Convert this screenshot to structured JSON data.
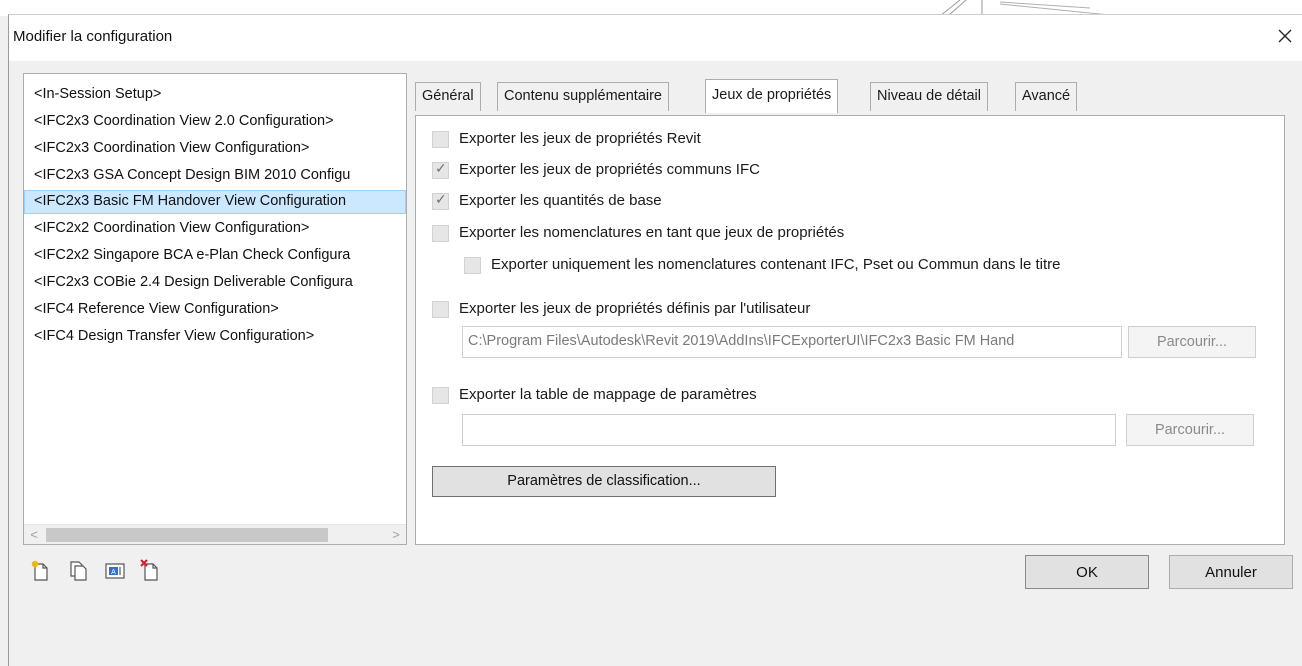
{
  "dialog": {
    "title": "Modifier la configuration",
    "close_icon": "close-icon"
  },
  "configurations": [
    {
      "label": "<In-Session Setup>",
      "selected": false
    },
    {
      "label": "<IFC2x3 Coordination View 2.0 Configuration>",
      "selected": false
    },
    {
      "label": "<IFC2x3 Coordination View Configuration>",
      "selected": false
    },
    {
      "label": "<IFC2x3 GSA Concept Design BIM 2010 Configu",
      "selected": false
    },
    {
      "label": "<IFC2x3 Basic FM Handover View Configuration",
      "selected": true
    },
    {
      "label": "<IFC2x2 Coordination View Configuration>",
      "selected": false
    },
    {
      "label": "<IFC2x2 Singapore BCA e-Plan Check Configura",
      "selected": false
    },
    {
      "label": "<IFC2x3 COBie 2.4 Design Deliverable Configura",
      "selected": false
    },
    {
      "label": "<IFC4 Reference View Configuration>",
      "selected": false
    },
    {
      "label": "<IFC4 Design Transfer View Configuration>",
      "selected": false
    }
  ],
  "list_scroll": {
    "left": "<",
    "right": ">"
  },
  "toolbar": [
    "new-configuration-icon",
    "duplicate-configuration-icon",
    "rename-configuration-icon",
    "delete-configuration-icon"
  ],
  "tabs": [
    {
      "label": "Général",
      "active": false
    },
    {
      "label": "Contenu supplémentaire",
      "active": false
    },
    {
      "label": "Jeux de propriétés",
      "active": true
    },
    {
      "label": "Niveau de détail",
      "active": false
    },
    {
      "label": "Avancé",
      "active": false
    }
  ],
  "property_sets": {
    "export_revit_psets": {
      "label": "Exporter les jeux de propriétés Revit",
      "checked": false
    },
    "export_ifc_common_psets": {
      "label": "Exporter les jeux de propriétés communs IFC",
      "checked": true
    },
    "export_base_quantities": {
      "label": "Exporter les quantités de base",
      "checked": true
    },
    "export_schedules_as_psets": {
      "label": "Exporter les nomenclatures en tant que jeux de propriétés",
      "checked": false
    },
    "export_only_titled_schedules": {
      "label": "Exporter uniquement les nomenclatures contenant IFC, Pset ou Commun dans le titre",
      "checked": false
    },
    "export_user_defined_psets": {
      "label": "Exporter les jeux de propriétés définis par l'utilisateur",
      "checked": false
    },
    "user_defined_psets_path": "C:\\Program Files\\Autodesk\\Revit 2019\\AddIns\\IFCExporterUI\\IFC2x3 Basic FM Hand",
    "browse_label_1": "Parcourir...",
    "export_parameter_mapping": {
      "label": "Exporter la table de mappage de paramètres",
      "checked": false
    },
    "parameter_mapping_path": "",
    "browse_label_2": "Parcourir...",
    "classification_button": "Paramètres de classification..."
  },
  "buttons": {
    "ok": "OK",
    "cancel": "Annuler"
  },
  "colors": {
    "selection_bg": "#cce8ff",
    "selection_border": "#99d1ff",
    "dialog_bg": "#f0f0f0"
  }
}
